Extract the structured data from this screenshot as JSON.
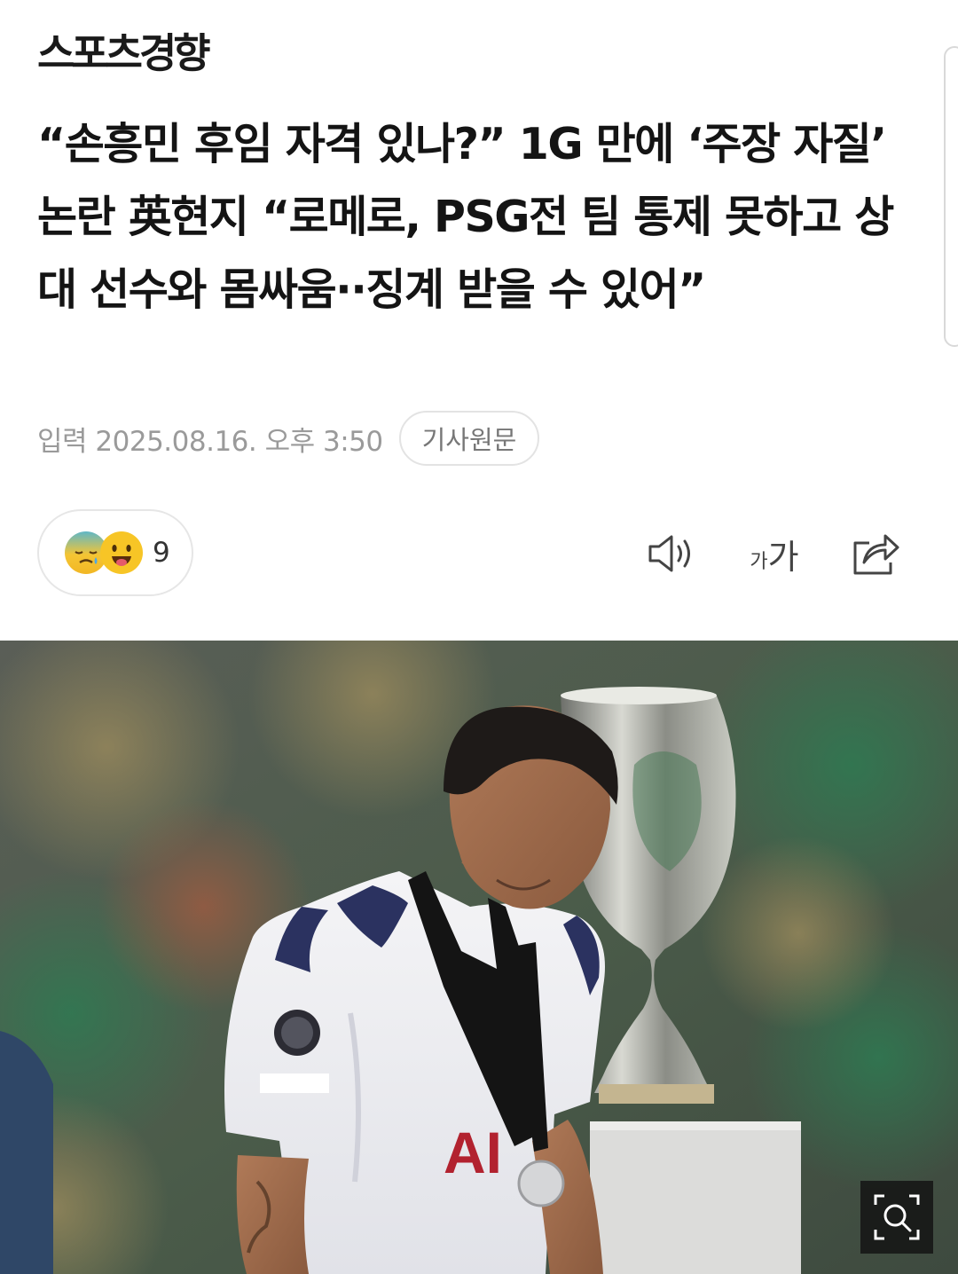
{
  "brand": {
    "name": "스포츠경향"
  },
  "article": {
    "headline": "“손흥민 후임 자격 있나?” 1G 만에 ‘주장 자질’ 논란 英현지 “로메로, PSG전 팀 통제 못하고 상대 선수와 몸싸움··징계 받을 수 있어”",
    "published": "입력 2025.08.16. 오후 3:50",
    "original_button": "기사원문"
  },
  "reactions": {
    "icons": [
      "sad-face-icon",
      "tongue-face-icon"
    ],
    "count": "9"
  },
  "toolbar": {
    "tts_icon": "speaker-icon",
    "font_small": "가",
    "font_large": "가",
    "share_icon": "share-icon"
  },
  "photo": {
    "description_icon": "photo",
    "zoom_icon": "zoom-search-icon",
    "jersey_sponsor": "AI"
  },
  "colors": {
    "text": "#141414",
    "meta": "#9a9a9a",
    "border": "#e3e3e3",
    "emoji": "#f7c526"
  }
}
